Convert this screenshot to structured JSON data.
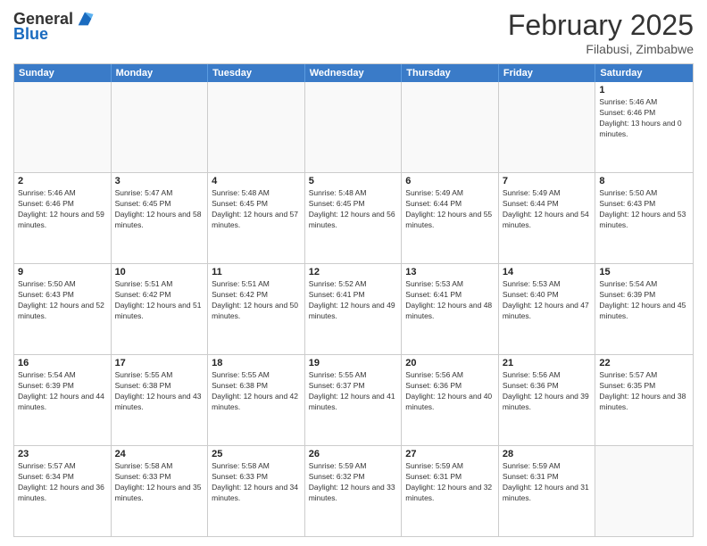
{
  "header": {
    "logo_general": "General",
    "logo_blue": "Blue",
    "month_title": "February 2025",
    "location": "Filabusi, Zimbabwe"
  },
  "calendar": {
    "weekdays": [
      "Sunday",
      "Monday",
      "Tuesday",
      "Wednesday",
      "Thursday",
      "Friday",
      "Saturday"
    ],
    "rows": [
      [
        {
          "day": "",
          "sunrise": "",
          "sunset": "",
          "daylight": ""
        },
        {
          "day": "",
          "sunrise": "",
          "sunset": "",
          "daylight": ""
        },
        {
          "day": "",
          "sunrise": "",
          "sunset": "",
          "daylight": ""
        },
        {
          "day": "",
          "sunrise": "",
          "sunset": "",
          "daylight": ""
        },
        {
          "day": "",
          "sunrise": "",
          "sunset": "",
          "daylight": ""
        },
        {
          "day": "",
          "sunrise": "",
          "sunset": "",
          "daylight": ""
        },
        {
          "day": "1",
          "sunrise": "Sunrise: 5:46 AM",
          "sunset": "Sunset: 6:46 PM",
          "daylight": "Daylight: 13 hours and 0 minutes."
        }
      ],
      [
        {
          "day": "2",
          "sunrise": "Sunrise: 5:46 AM",
          "sunset": "Sunset: 6:46 PM",
          "daylight": "Daylight: 12 hours and 59 minutes."
        },
        {
          "day": "3",
          "sunrise": "Sunrise: 5:47 AM",
          "sunset": "Sunset: 6:45 PM",
          "daylight": "Daylight: 12 hours and 58 minutes."
        },
        {
          "day": "4",
          "sunrise": "Sunrise: 5:48 AM",
          "sunset": "Sunset: 6:45 PM",
          "daylight": "Daylight: 12 hours and 57 minutes."
        },
        {
          "day": "5",
          "sunrise": "Sunrise: 5:48 AM",
          "sunset": "Sunset: 6:45 PM",
          "daylight": "Daylight: 12 hours and 56 minutes."
        },
        {
          "day": "6",
          "sunrise": "Sunrise: 5:49 AM",
          "sunset": "Sunset: 6:44 PM",
          "daylight": "Daylight: 12 hours and 55 minutes."
        },
        {
          "day": "7",
          "sunrise": "Sunrise: 5:49 AM",
          "sunset": "Sunset: 6:44 PM",
          "daylight": "Daylight: 12 hours and 54 minutes."
        },
        {
          "day": "8",
          "sunrise": "Sunrise: 5:50 AM",
          "sunset": "Sunset: 6:43 PM",
          "daylight": "Daylight: 12 hours and 53 minutes."
        }
      ],
      [
        {
          "day": "9",
          "sunrise": "Sunrise: 5:50 AM",
          "sunset": "Sunset: 6:43 PM",
          "daylight": "Daylight: 12 hours and 52 minutes."
        },
        {
          "day": "10",
          "sunrise": "Sunrise: 5:51 AM",
          "sunset": "Sunset: 6:42 PM",
          "daylight": "Daylight: 12 hours and 51 minutes."
        },
        {
          "day": "11",
          "sunrise": "Sunrise: 5:51 AM",
          "sunset": "Sunset: 6:42 PM",
          "daylight": "Daylight: 12 hours and 50 minutes."
        },
        {
          "day": "12",
          "sunrise": "Sunrise: 5:52 AM",
          "sunset": "Sunset: 6:41 PM",
          "daylight": "Daylight: 12 hours and 49 minutes."
        },
        {
          "day": "13",
          "sunrise": "Sunrise: 5:53 AM",
          "sunset": "Sunset: 6:41 PM",
          "daylight": "Daylight: 12 hours and 48 minutes."
        },
        {
          "day": "14",
          "sunrise": "Sunrise: 5:53 AM",
          "sunset": "Sunset: 6:40 PM",
          "daylight": "Daylight: 12 hours and 47 minutes."
        },
        {
          "day": "15",
          "sunrise": "Sunrise: 5:54 AM",
          "sunset": "Sunset: 6:39 PM",
          "daylight": "Daylight: 12 hours and 45 minutes."
        }
      ],
      [
        {
          "day": "16",
          "sunrise": "Sunrise: 5:54 AM",
          "sunset": "Sunset: 6:39 PM",
          "daylight": "Daylight: 12 hours and 44 minutes."
        },
        {
          "day": "17",
          "sunrise": "Sunrise: 5:55 AM",
          "sunset": "Sunset: 6:38 PM",
          "daylight": "Daylight: 12 hours and 43 minutes."
        },
        {
          "day": "18",
          "sunrise": "Sunrise: 5:55 AM",
          "sunset": "Sunset: 6:38 PM",
          "daylight": "Daylight: 12 hours and 42 minutes."
        },
        {
          "day": "19",
          "sunrise": "Sunrise: 5:55 AM",
          "sunset": "Sunset: 6:37 PM",
          "daylight": "Daylight: 12 hours and 41 minutes."
        },
        {
          "day": "20",
          "sunrise": "Sunrise: 5:56 AM",
          "sunset": "Sunset: 6:36 PM",
          "daylight": "Daylight: 12 hours and 40 minutes."
        },
        {
          "day": "21",
          "sunrise": "Sunrise: 5:56 AM",
          "sunset": "Sunset: 6:36 PM",
          "daylight": "Daylight: 12 hours and 39 minutes."
        },
        {
          "day": "22",
          "sunrise": "Sunrise: 5:57 AM",
          "sunset": "Sunset: 6:35 PM",
          "daylight": "Daylight: 12 hours and 38 minutes."
        }
      ],
      [
        {
          "day": "23",
          "sunrise": "Sunrise: 5:57 AM",
          "sunset": "Sunset: 6:34 PM",
          "daylight": "Daylight: 12 hours and 36 minutes."
        },
        {
          "day": "24",
          "sunrise": "Sunrise: 5:58 AM",
          "sunset": "Sunset: 6:33 PM",
          "daylight": "Daylight: 12 hours and 35 minutes."
        },
        {
          "day": "25",
          "sunrise": "Sunrise: 5:58 AM",
          "sunset": "Sunset: 6:33 PM",
          "daylight": "Daylight: 12 hours and 34 minutes."
        },
        {
          "day": "26",
          "sunrise": "Sunrise: 5:59 AM",
          "sunset": "Sunset: 6:32 PM",
          "daylight": "Daylight: 12 hours and 33 minutes."
        },
        {
          "day": "27",
          "sunrise": "Sunrise: 5:59 AM",
          "sunset": "Sunset: 6:31 PM",
          "daylight": "Daylight: 12 hours and 32 minutes."
        },
        {
          "day": "28",
          "sunrise": "Sunrise: 5:59 AM",
          "sunset": "Sunset: 6:31 PM",
          "daylight": "Daylight: 12 hours and 31 minutes."
        },
        {
          "day": "",
          "sunrise": "",
          "sunset": "",
          "daylight": ""
        }
      ]
    ]
  }
}
